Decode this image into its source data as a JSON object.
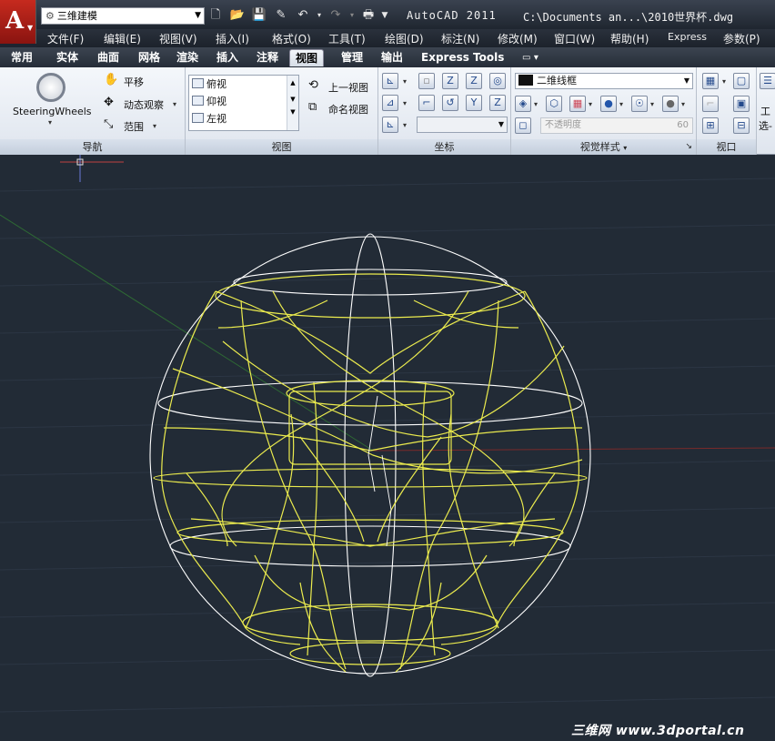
{
  "app": {
    "title": "AutoCAD 2011",
    "document_path": "C:\\Documents an...\\2010世界杯.dwg",
    "logo_letter": "A"
  },
  "workspace": {
    "value": "三维建模"
  },
  "menu": [
    "文件(F)",
    "编辑(E)",
    "视图(V)",
    "插入(I)",
    "格式(O)",
    "工具(T)",
    "绘图(D)",
    "标注(N)",
    "修改(M)",
    "窗口(W)",
    "帮助(H)",
    "Express",
    "参数(P)"
  ],
  "tabs": [
    "常用",
    "实体",
    "曲面",
    "网格",
    "渲染",
    "插入",
    "注释",
    "视图",
    "管理",
    "输出",
    "Express Tools"
  ],
  "active_tab": "视图",
  "ribbon": {
    "navigate": {
      "title": "导航",
      "steering": "SteeringWheels",
      "pan": "平移",
      "orbit": "动态观察",
      "extents": "范围"
    },
    "views": {
      "title": "视图",
      "items": [
        "俯视",
        "仰视",
        "左视"
      ],
      "prev_view": "上一视图",
      "named_views": "命名视图"
    },
    "coords": {
      "title": "坐标"
    },
    "visual_styles": {
      "title": "视觉样式",
      "style": "二维线框",
      "opacity_label": "不透明度",
      "opacity_value": "60"
    },
    "viewports": {
      "title": "视口",
      "extra": "工",
      "extra2": "选-"
    }
  },
  "viewport": {
    "watermark": "三维网 www.3dportal.cn",
    "wireframe_color": "#e8e84a",
    "sphere_color": "#ffffff",
    "background": "#222b36"
  }
}
